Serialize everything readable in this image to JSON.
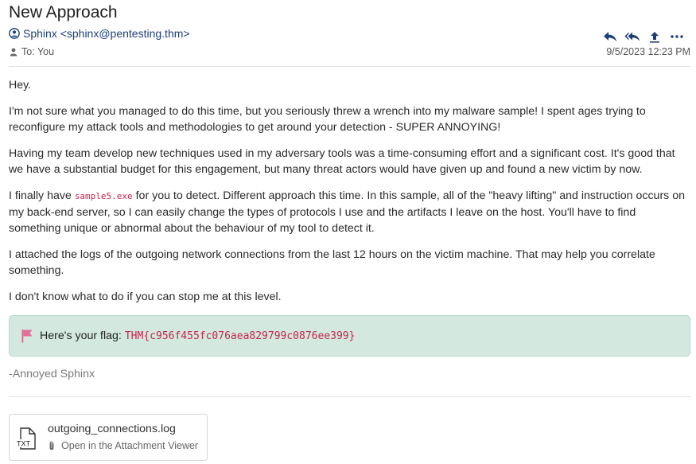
{
  "email": {
    "subject": "New Approach",
    "from": "Sphinx <sphinx@pentesting.thm>",
    "to": "To: You",
    "date": "9/5/2023 12:23 PM",
    "actions": [
      "reply-icon",
      "reply-all-icon",
      "forward-icon",
      "more-icon"
    ]
  },
  "body": {
    "p1": "Hey.",
    "p2": "I'm not sure what you managed to do this time, but you seriously threw a wrench into my malware sample! I spent ages trying to reconfigure my attack tools and methodologies to get around your detection - SUPER ANNOYING!",
    "p3": "Having my team develop new techniques used in my adversary tools was a time-consuming effort and a significant cost. It's good that we have a substantial budget for this engagement, but many threat actors would have given up and found a new victim by now.",
    "p4_pre": "I finally have ",
    "p4_code": "sample5.exe",
    "p4_post": " for you to detect. Different approach this time. In this sample, all of the \"heavy lifting\" and instruction occurs on my back-end server, so I can easily change the types of protocols I use and the artifacts I leave on the host. You'll have to find something unique or abnormal about the behaviour of my tool to detect it.",
    "p5": "I attached the logs of the outgoing network connections from the last 12 hours on the victim machine. That may help you correlate something.",
    "p6": "I don't know what to do if you can stop me at this level."
  },
  "flag": {
    "label": "Here's your flag:",
    "value": "THM{c956f455fc076aea829799c0876ee399}",
    "accent": "#c7254e",
    "box_color": "#d3e9e0"
  },
  "signature": "-Annoyed Sphinx",
  "attachment": {
    "filename": "outgoing_connections.log",
    "open_label": "Open in the Attachment Viewer",
    "type_label": "TXT"
  }
}
